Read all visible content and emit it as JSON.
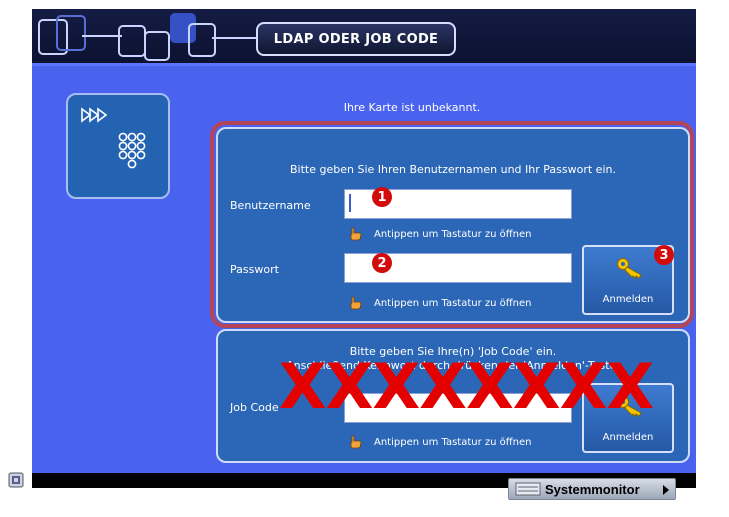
{
  "header": {
    "title": "LDAP ODER JOB CODE"
  },
  "message": {
    "unknown_card": "Ihre Karte ist unbekannt."
  },
  "ldap": {
    "instruction": "Bitte geben Sie Ihren Benutzernamen und Ihr Passwort ein.",
    "username_label": "Benutzername",
    "username_value": "",
    "username_hint": "Antippen um Tastatur zu öffnen",
    "password_label": "Passwort",
    "password_value": "",
    "password_hint": "Antippen um Tastatur zu öffnen",
    "login_label": "Anmelden"
  },
  "jobcode": {
    "instruction_line1": "Bitte geben Sie Ihre(n) 'Job Code' ein.",
    "instruction_line2": "Anschließend Kennwort durch drücken der 'Anmelden'-Taste.",
    "label": "Job Code",
    "value": "",
    "hint": "Antippen um Tastatur zu öffnen",
    "login_label": "Anmelden"
  },
  "annotations": {
    "marker1": "1",
    "marker2": "2",
    "marker3": "3",
    "redaction": "XXXXXXXX"
  },
  "footer": {
    "system_monitor": "Systemmonitor"
  },
  "colors": {
    "screen_bg": "#4a63ef",
    "panel_bg": "#2b67b6",
    "highlight_border": "#b44558",
    "marker_red": "#d20b0b"
  }
}
